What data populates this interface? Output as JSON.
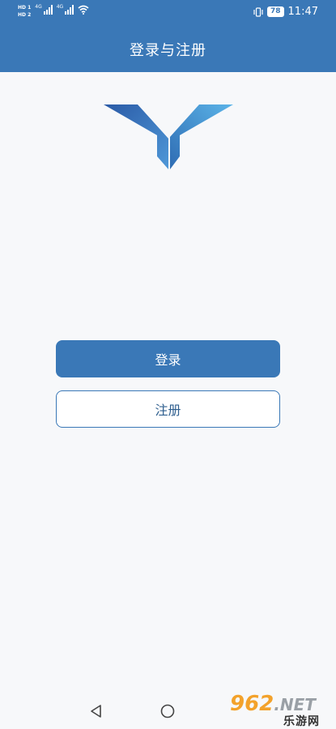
{
  "status_bar": {
    "sim1": "HD 1",
    "sim2": "HD 2",
    "net1": "4G",
    "net2": "4G",
    "battery": "78",
    "time": "11:47"
  },
  "header": {
    "title": "登录与注册"
  },
  "actions": {
    "login_label": "登录",
    "register_label": "注册"
  },
  "nav": {
    "back_icon": "triangle-back-icon",
    "home_icon": "circle-home-icon"
  },
  "watermark": {
    "brand": "962",
    "domain": ".NET",
    "name": "乐游网"
  },
  "colors": {
    "primary": "#3a78b7",
    "background": "#f7f8fa",
    "watermark_orange": "#f3a22b"
  }
}
